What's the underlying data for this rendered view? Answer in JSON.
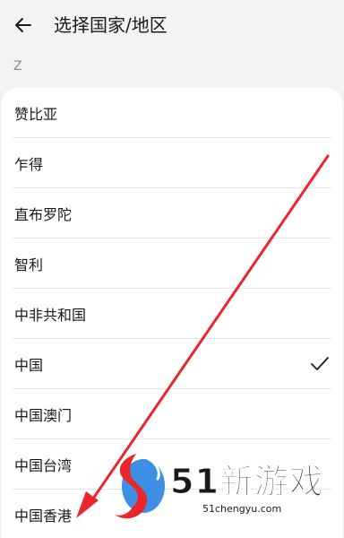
{
  "header": {
    "title": "选择国家/地区"
  },
  "section": {
    "letter": "Z"
  },
  "countries": [
    {
      "label": "赞比亚"
    },
    {
      "label": "乍得"
    },
    {
      "label": "直布罗陀"
    },
    {
      "label": "智利"
    },
    {
      "label": "中非共和国"
    },
    {
      "label": "中国",
      "selected": true
    },
    {
      "label": "中国澳门"
    },
    {
      "label": "中国台湾"
    },
    {
      "label": "中国香港"
    }
  ],
  "watermark": {
    "brand": "51新游戏",
    "url": "51chengyu.com"
  },
  "colors": {
    "annotation": "#e8262c",
    "accent_blue": "#3d8fe3",
    "accent_red": "#e8262c"
  }
}
